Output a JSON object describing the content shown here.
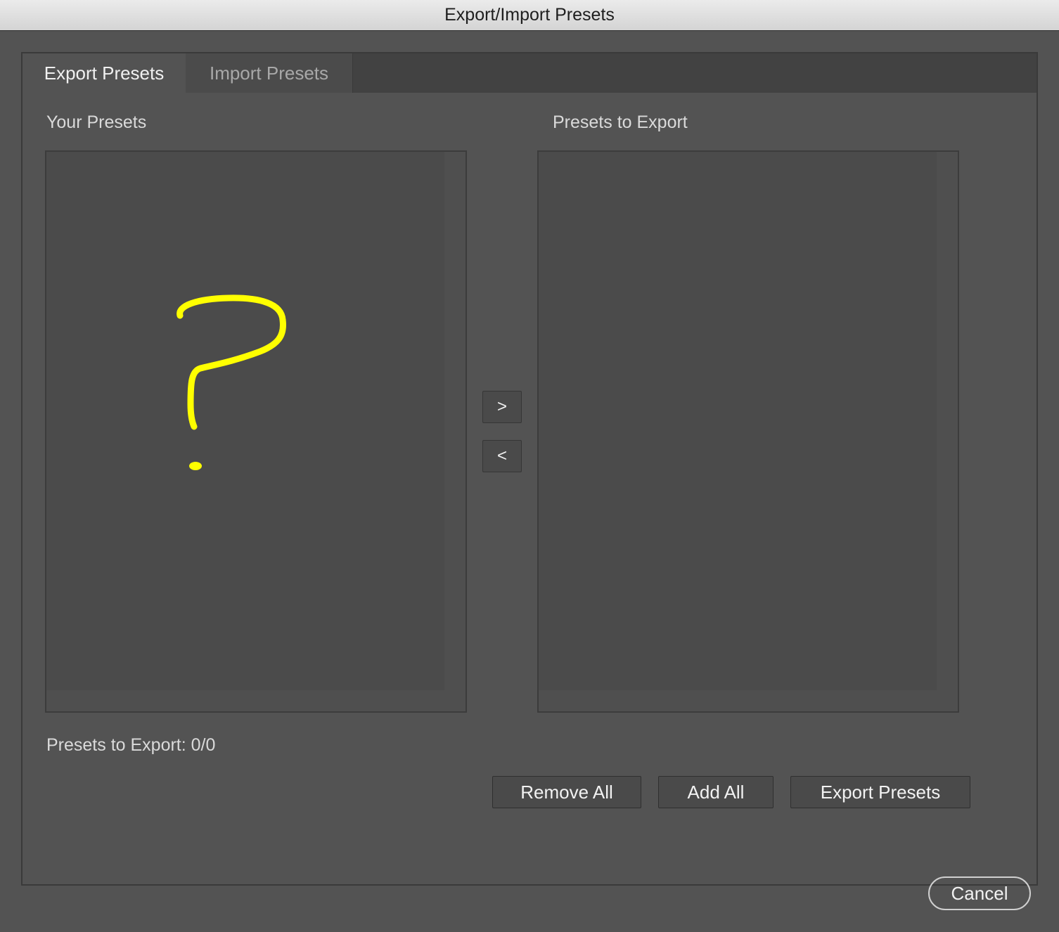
{
  "window": {
    "title": "Export/Import Presets"
  },
  "tabs": [
    {
      "label": "Export Presets",
      "active": true
    },
    {
      "label": "Import Presets",
      "active": false
    }
  ],
  "left_list": {
    "label": "Your Presets",
    "items": []
  },
  "right_list": {
    "label": "Presets to Export",
    "items": []
  },
  "transfer": {
    "add_label": ">",
    "remove_label": "<"
  },
  "status": {
    "count_text": "Presets to Export: 0/0"
  },
  "actions": {
    "remove_all": "Remove All",
    "add_all": "Add All",
    "export": "Export Presets"
  },
  "footer": {
    "cancel": "Cancel"
  },
  "colors": {
    "background": "#535353",
    "annotation": "#ffff00"
  }
}
